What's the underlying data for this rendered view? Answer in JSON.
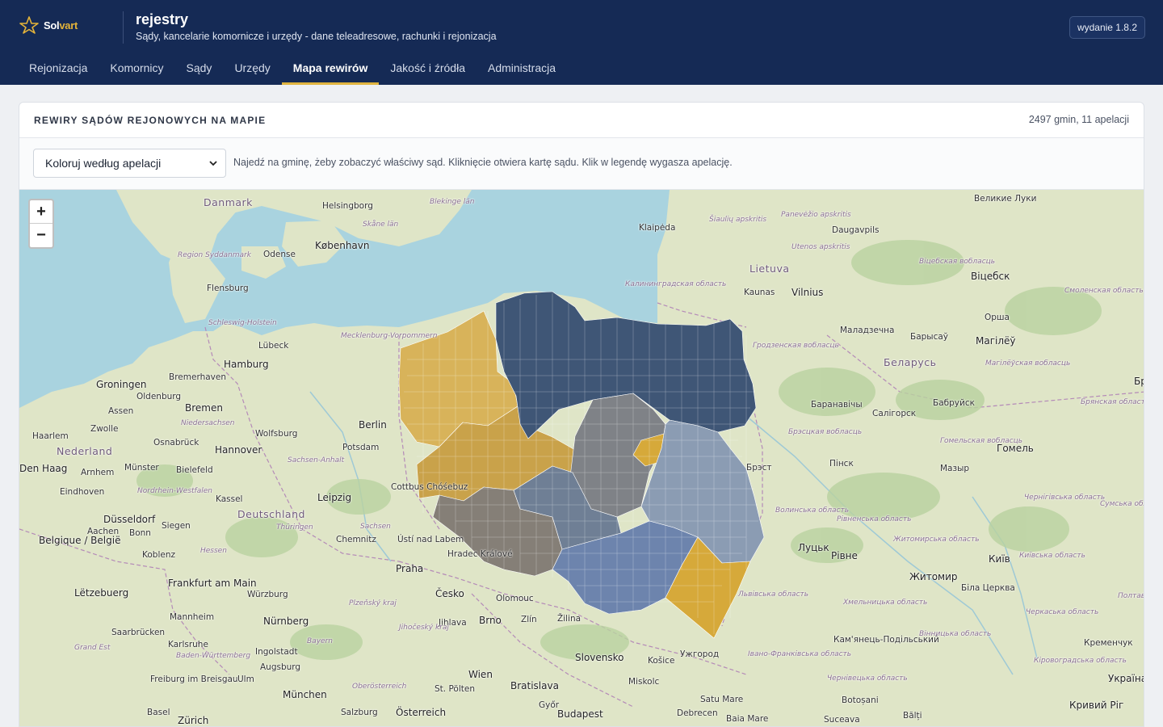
{
  "brand": {
    "name_a": "Sol",
    "name_b": "vart"
  },
  "app": {
    "title": "rejestry",
    "subtitle": "Sądy, kancelarie komornicze i urzędy - dane teleadresowe, rachunki i rejonizacja",
    "version": "wydanie 1.8.2"
  },
  "nav": [
    {
      "label": "Rejonizacja",
      "active": false
    },
    {
      "label": "Komornicy",
      "active": false
    },
    {
      "label": "Sądy",
      "active": false
    },
    {
      "label": "Urzędy",
      "active": false
    },
    {
      "label": "Mapa rewirów",
      "active": true
    },
    {
      "label": "Jakość i źródła",
      "active": false
    },
    {
      "label": "Administracja",
      "active": false
    }
  ],
  "card": {
    "title": "REWIRY SĄDÓW REJONOWYCH NA MAPIE",
    "count": "2497 gmin, 11 apelacji",
    "select_value": "Koloruj według apelacji",
    "hint": "Najedź na gminę, żeby zobaczyć właściwy sąd. Kliknięcie otwiera kartę sądu. Klik w legendę wygasza apelację."
  },
  "map": {
    "zoom_in": "+",
    "zoom_out": "−",
    "colors": {
      "water": "#a9d3df",
      "land": "#dfe5c7",
      "ochre": "#d8b35a",
      "ochre_dark": "#c9a24a",
      "navy": "#3f5676",
      "slate": "#6f7f95",
      "gray": "#7f8287",
      "taupe": "#857f77",
      "blue": "#6d84ad",
      "steel": "#8b9cb3",
      "gold": "#d6a93a"
    },
    "labels": [
      "Danmark",
      "Helsingborg",
      "Blekinge län",
      "Skåne län",
      "København",
      "Region Syddanmark",
      "Odense",
      "Flensburg",
      "Schleswig-Holstein",
      "Mecklenburg-Vorpommern",
      "Lübeck",
      "Hamburg",
      "Bremerhaven",
      "Groningen",
      "Oldenburg",
      "Bremen",
      "Assen",
      "Zwolle",
      "Niedersachsen",
      "Wolfsburg",
      "Berlin",
      "Haarlem",
      "Nederland",
      "Osnabrück",
      "Hannover",
      "Potsdam",
      "Den Haag",
      "Arnhem",
      "Münster",
      "Bielefeld",
      "Sachsen-Anhalt",
      "Eindhoven",
      "Nordrhein-Westfalen",
      "Kassel",
      "Leipzig",
      "Cottbus Chóśebuz",
      "Düsseldorf",
      "Deutschland",
      "Thüringen",
      "Sachsen",
      "Aachen",
      "Bonn",
      "Siegen",
      "Chemnitz",
      "Ústí nad Labem",
      "Belgique / België",
      "Koblenz",
      "Hessen",
      "Hradec Králové",
      "Praha",
      "Frankfurt am Main",
      "Würzburg",
      "Česko",
      "Olomouc",
      "Lëtzebuerg",
      "Mannheim",
      "Plzeňský kraj",
      "Nürnberg",
      "Jihlava",
      "Brno",
      "Zlín",
      "Žilina",
      "Saarbrücken",
      "Karlsruhe",
      "Bayern",
      "Jihočeský kraj",
      "Grand Est",
      "Baden-Württemberg",
      "Ingolstadt",
      "Augsburg",
      "Slovensko",
      "Košice",
      "Freiburg im Breisgau",
      "Ulm",
      "Wien",
      "Oberösterreich",
      "Bratislava",
      "St. Pölten",
      "Miskolc",
      "München",
      "Basel",
      "Zürich",
      "Salzburg",
      "Österreich",
      "Győr",
      "Budapest",
      "Debrecen",
      "Satu Mare",
      "Baia Mare",
      "Klaipėda",
      "Šiaulių apskritis",
      "Panevėžio apskritis",
      "Daugavpils",
      "Utenos apskritis",
      "Lietuva",
      "Kaunas",
      "Vilnius",
      "Калининградская область",
      "Великие Луки",
      "Віцебская вобласць",
      "Віцебск",
      "Смоленская область",
      "Орша",
      "Маладзечна",
      "Барысаў",
      "Магілёў",
      "Гродзенская вобласць",
      "Беларусь",
      "Магілёўская вобласць",
      "Брянская область",
      "Баранавічы",
      "Бабруйск",
      "Салігорск",
      "Брэсцкая вобласць",
      "Гомельская вобласць",
      "Гомель",
      "Пінск",
      "Мазыр",
      "Брэст",
      "Чернігівська область",
      "Сумська область",
      "Волинська область",
      "Рівненська область",
      "Житомирська область",
      "Луцьк",
      "Рівне",
      "Київ",
      "Київська область",
      "Житомир",
      "Біла Церква",
      "Полтавська область",
      "Львівська область",
      "Хмельницька область",
      "Черкаська область",
      "Кам'янець-Подільський",
      "Вінницька область",
      "Кременчук",
      "Івано-Франківська область",
      "Ужгород",
      "Кіровоградська область",
      "Україна",
      "Чернівецька область",
      "Botoșani",
      "Suceava",
      "Bălți",
      "Кривий Ріг",
      "Брян"
    ]
  }
}
